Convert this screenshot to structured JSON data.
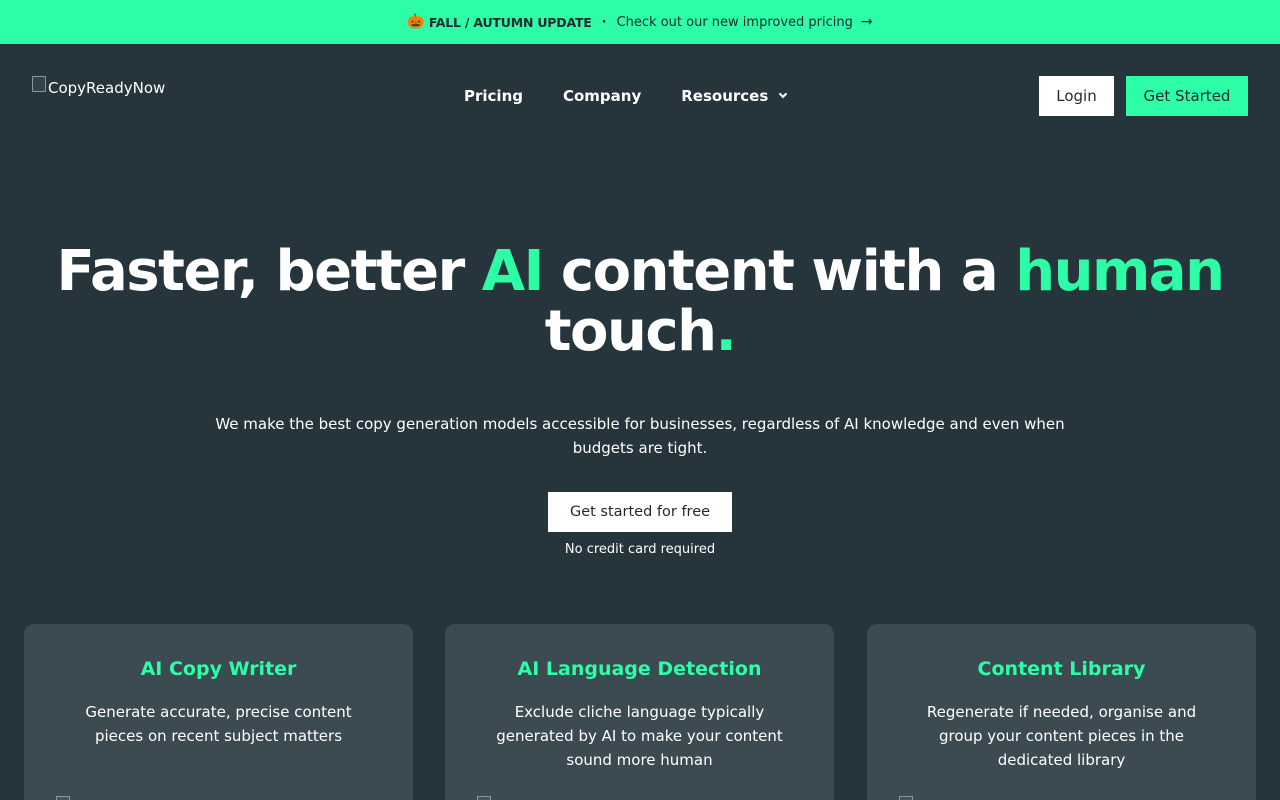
{
  "announcement": {
    "icon": "pumpkin-icon",
    "tag": "FALL / AUTUMN UPDATE",
    "separator": "·",
    "link_text": "Check out our new improved pricing",
    "arrow": "→"
  },
  "header": {
    "logo_alt": "CopyReadyNow",
    "nav": {
      "pricing": "Pricing",
      "company": "Company",
      "resources": "Resources"
    },
    "login_label": "Login",
    "get_started_label": "Get Started"
  },
  "hero": {
    "title_part1": "Faster, better ",
    "title_accent1": "AI",
    "title_part2": " content with a ",
    "title_accent2": "human",
    "title_part3": " touch",
    "title_period": ".",
    "subtitle": "We make the best copy generation models accessible for businesses, regardless of AI knowledge and even when budgets are tight.",
    "cta_label": "Get started for free",
    "cta_note": "No credit card required"
  },
  "features": [
    {
      "title": "AI Copy Writer",
      "description": "Generate accurate, precise content pieces on recent subject matters"
    },
    {
      "title": "AI Language Detection",
      "description": "Exclude cliche language typically generated by AI to make your content sound more human"
    },
    {
      "title": "Content Library",
      "description": "Regenerate if needed, organise and group your content pieces in the dedicated library"
    }
  ],
  "colors": {
    "accent": "#2dfda6",
    "background": "#26343c",
    "card": "#3c4a51"
  }
}
